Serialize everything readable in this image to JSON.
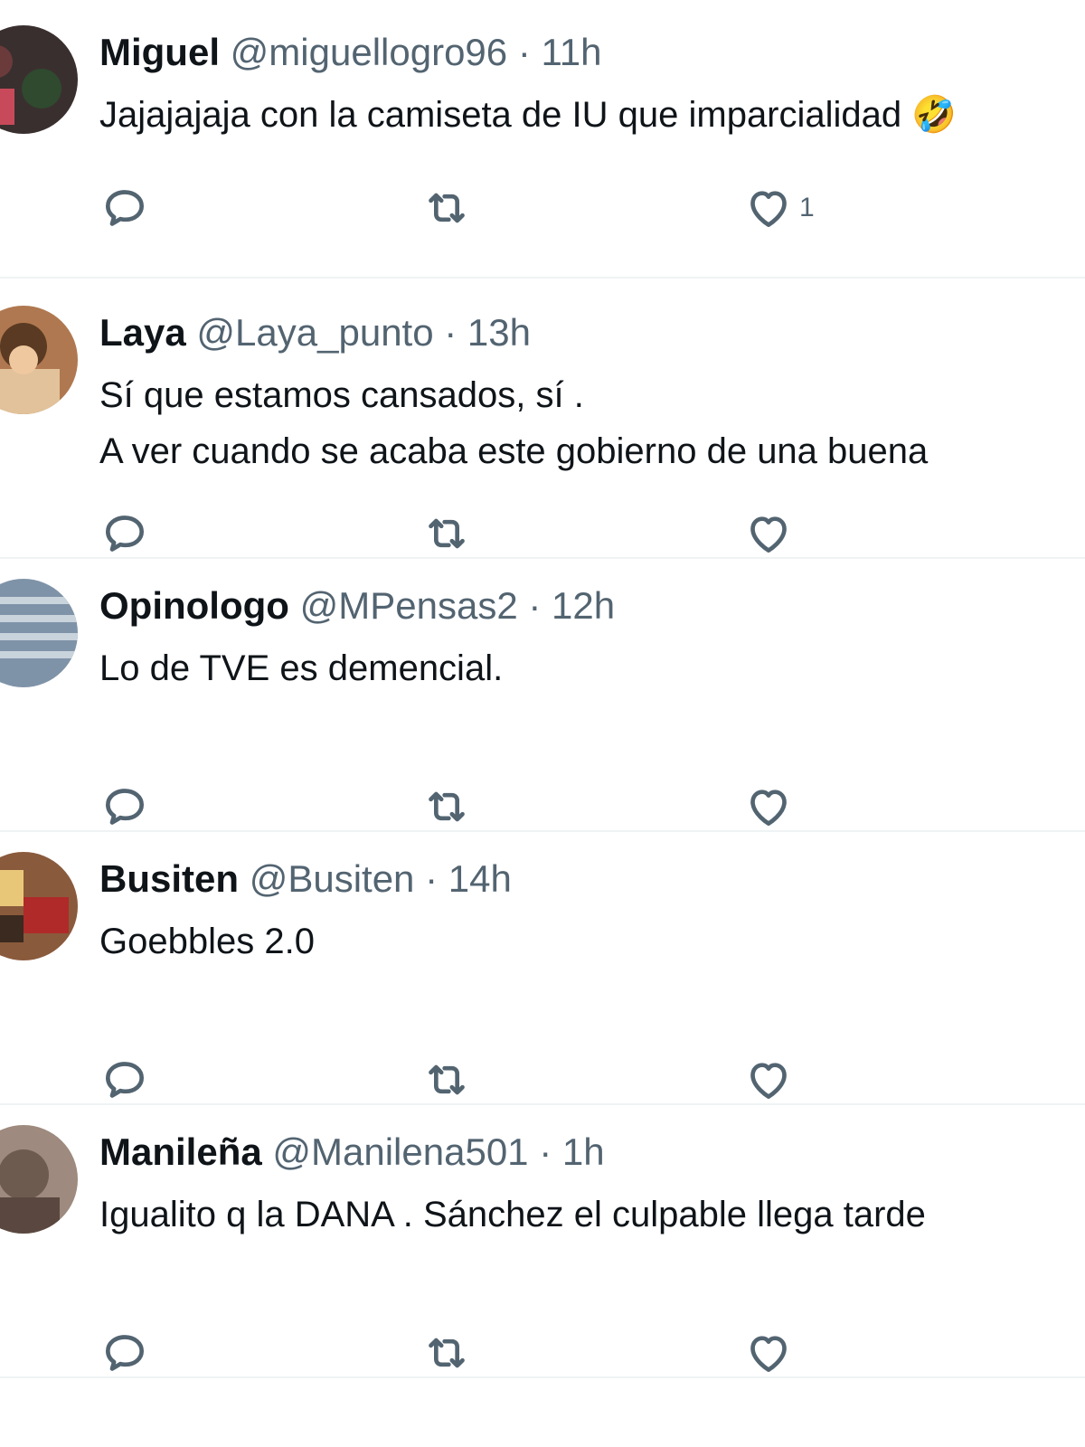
{
  "tweets": [
    {
      "name": "Miguel",
      "handle": "@miguellogro96",
      "separator": "·",
      "time": "11h",
      "text": "Jajajajaja con la camiseta de IU que imparcialidad 🤣",
      "likes": "1",
      "avatar_color": "#3a2f2f"
    },
    {
      "name": "Laya",
      "handle": "@Laya_punto",
      "separator": "·",
      "time": "13h",
      "text": "Sí que estamos cansados, sí .\nA ver cuando se acaba este gobierno de una buena",
      "likes": "",
      "avatar_color": "#b07850"
    },
    {
      "name": "Opinologo",
      "handle": "@MPensas2",
      "separator": "·",
      "time": "12h",
      "text": "Lo de TVE es demencial.",
      "likes": "",
      "avatar_color": "#7f93a8"
    },
    {
      "name": "Busiten",
      "handle": "@Busiten",
      "separator": "·",
      "time": "14h",
      "text": "Goebbles 2.0",
      "likes": "",
      "avatar_color": "#8a5a3c"
    },
    {
      "name": "Manileña",
      "handle": "@Manilena501",
      "separator": "·",
      "time": "1h",
      "text": "Igualito q la DANA . Sánchez el culpable llega tarde",
      "likes": "",
      "avatar_color": "#9e8a7e"
    }
  ],
  "icons": {
    "reply": "reply-icon",
    "retweet": "retweet-icon",
    "like": "heart-icon"
  },
  "colors": {
    "text_primary": "#0f1419",
    "text_secondary": "#536471",
    "divider": "#eff3f4",
    "icon": "#536471"
  }
}
